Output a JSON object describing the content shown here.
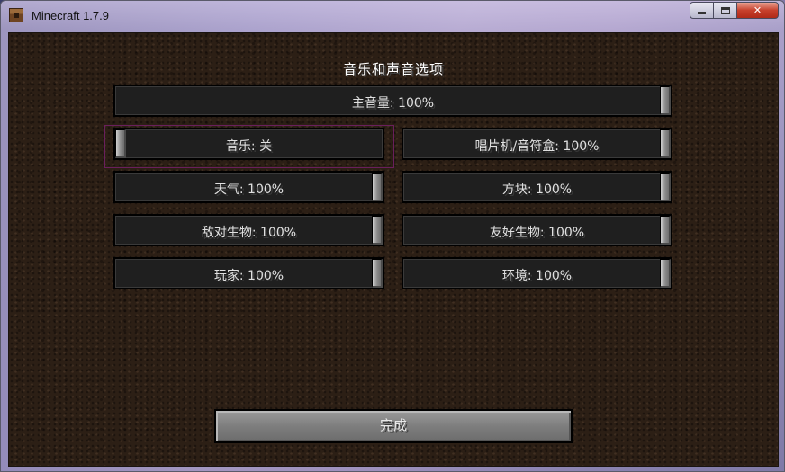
{
  "window": {
    "title": "Minecraft 1.7.9"
  },
  "controls": {
    "minimize": "minimize",
    "maximize": "maximize",
    "close": "✕"
  },
  "screen": {
    "title": "音乐和声音选项",
    "master": {
      "label": "主音量: 100%",
      "value": 1.0
    },
    "sliders": [
      {
        "label": "音乐: 关",
        "value": 0.0
      },
      {
        "label": "唱片机/音符盒: 100%",
        "value": 1.0
      },
      {
        "label": "天气: 100%",
        "value": 1.0
      },
      {
        "label": "方块: 100%",
        "value": 1.0
      },
      {
        "label": "敌对生物: 100%",
        "value": 1.0
      },
      {
        "label": "友好生物: 100%",
        "value": 1.0
      },
      {
        "label": "玩家: 100%",
        "value": 1.0
      },
      {
        "label": "环境: 100%",
        "value": 1.0
      }
    ],
    "done_label": "完成"
  }
}
